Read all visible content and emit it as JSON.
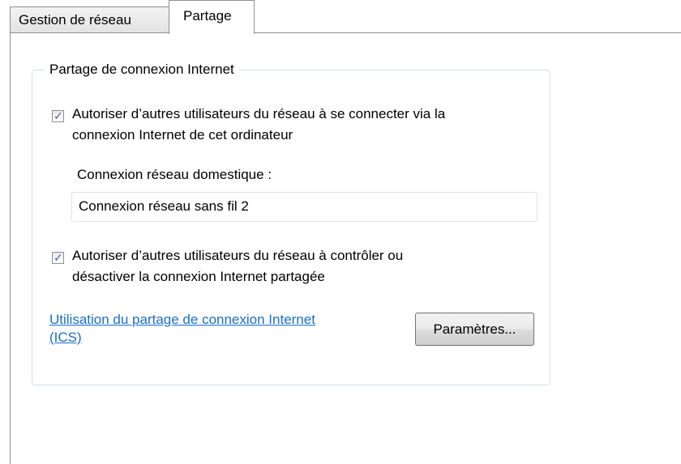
{
  "tabs": [
    {
      "label": "Gestion de réseau",
      "active": false
    },
    {
      "label": "Partage",
      "active": true
    }
  ],
  "group": {
    "title": "Partage de connexion Internet",
    "allow_connect": {
      "checked": true,
      "label_line1": "Autoriser d’autres utilisateurs du réseau à se connecter via la",
      "label_line2": "connexion Internet de cet ordinateur"
    },
    "home_network": {
      "label": "Connexion réseau domestique :",
      "value": "Connexion réseau sans fil 2"
    },
    "allow_control": {
      "checked": true,
      "label_line1": "Autoriser d’autres utilisateurs du réseau à contrôler ou",
      "label_line2": "désactiver la connexion Internet partagée"
    },
    "help_link": {
      "line1": "Utilisation du partage de connexion Internet",
      "line2": "(ICS)"
    },
    "settings_button": "Paramètres..."
  },
  "colors": {
    "link": "#1a6fc9",
    "checkmark": "#4a5f97",
    "border": "#8e8f8f",
    "groupbox_border": "#d5dfe5"
  },
  "icons": {
    "checkmark": "check-icon"
  }
}
